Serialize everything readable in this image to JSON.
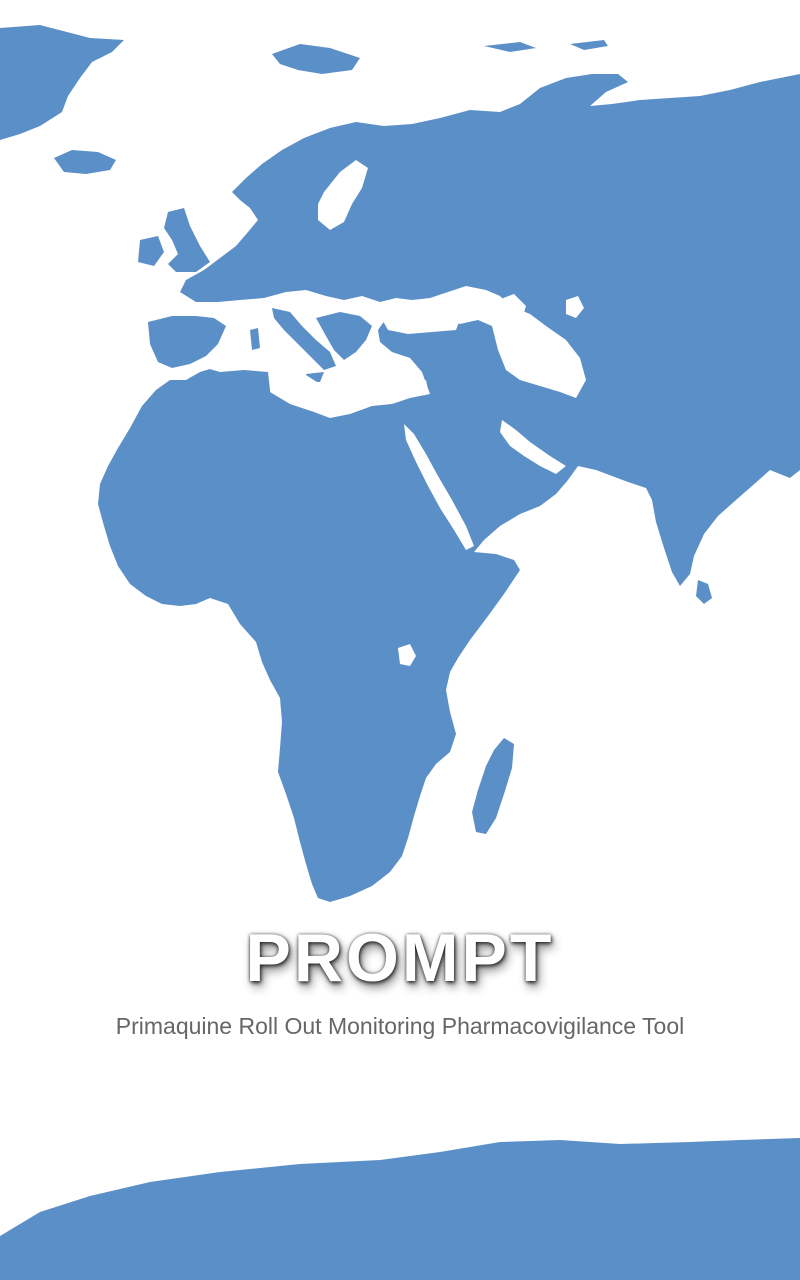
{
  "app": {
    "title": "PROMPT",
    "subtitle": "Primaquine Roll Out Monitoring Pharmacovigilance Tool"
  },
  "background": {
    "image": "world-map",
    "land_color": "#5b8fc7",
    "sea_color": "#ffffff"
  }
}
